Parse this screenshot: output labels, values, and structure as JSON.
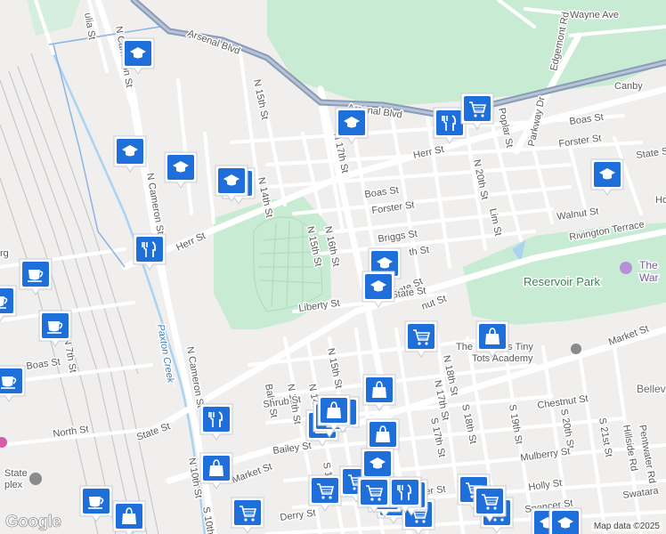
{
  "colors": {
    "accent": "#1a73e8",
    "marker_bg": "#1e6fd9",
    "park": "#c8ecd3",
    "road": "#ffffff",
    "highway": "#8a9bb5",
    "water": "#a9d3f0"
  },
  "attribution": "Map data ©2025",
  "logo": "Google",
  "streets": [
    {
      "label": "Arsenal Blvd",
      "rot": 20
    },
    {
      "label": "Arsenal Blvd",
      "rot": 8
    },
    {
      "label": "Wayne Ave",
      "rot": 0
    },
    {
      "label": "Edgemont Rd",
      "rot": -78
    },
    {
      "label": "Herr St",
      "rot": -12
    },
    {
      "label": "Canby",
      "rot": 0
    },
    {
      "label": "Boas St",
      "rot": -8
    },
    {
      "label": "Forster St",
      "rot": -8
    },
    {
      "label": "State St",
      "rot": -8
    },
    {
      "label": "Parkway Dr",
      "rot": -78
    },
    {
      "label": "Poplar St",
      "rot": 78
    },
    {
      "label": "N 20th St",
      "rot": 78
    },
    {
      "label": "N 17th St",
      "rot": 78
    },
    {
      "label": "N 15th St",
      "rot": 78
    },
    {
      "label": "N 14th St",
      "rot": 78
    },
    {
      "label": "N 16th St",
      "rot": 78
    },
    {
      "label": "N 15th St",
      "rot": 78
    },
    {
      "label": "Boas St",
      "rot": -8
    },
    {
      "label": "Forster St",
      "rot": -8
    },
    {
      "label": "Briggs St",
      "rot": -8
    },
    {
      "label": "Lim St",
      "rot": 78
    },
    {
      "label": "Walnut St",
      "rot": -8
    },
    {
      "label": "Rivington Terrace",
      "rot": -10
    },
    {
      "label": "Herr St",
      "rot": -25
    },
    {
      "label": "Liberty St",
      "rot": -8
    },
    {
      "label": "State St",
      "rot": -25
    },
    {
      "label": "nut St",
      "rot": -20
    },
    {
      "label": "th St",
      "rot": -8
    },
    {
      "label": "N Cameron St",
      "rot": 80
    },
    {
      "label": "N Cameron St",
      "rot": 80
    },
    {
      "label": "N Cameron St",
      "rot": 80
    },
    {
      "label": "ulia St",
      "rot": 80
    },
    {
      "label": "Boas St",
      "rot": -8
    },
    {
      "label": "N 7th St",
      "rot": 80
    },
    {
      "label": "North St",
      "rot": -8
    },
    {
      "label": "State St",
      "rot": -20
    },
    {
      "label": "N 10th St",
      "rot": 80
    },
    {
      "label": "Market St",
      "rot": -20
    },
    {
      "label": "Market St",
      "rot": -20
    },
    {
      "label": "Balm St",
      "rot": 80
    },
    {
      "label": "N 13th St",
      "rot": 80
    },
    {
      "label": "N 14th St",
      "rot": 80
    },
    {
      "label": "N 15th St",
      "rot": 78
    },
    {
      "label": "Shrub St",
      "rot": -8
    },
    {
      "label": "Bailey St",
      "rot": -8
    },
    {
      "label": "N 17th St",
      "rot": 78
    },
    {
      "label": "N 18th St",
      "rot": 78
    },
    {
      "label": "S 17th St",
      "rot": 78
    },
    {
      "label": "S 18th St",
      "rot": 78
    },
    {
      "label": "S 19th St",
      "rot": 80
    },
    {
      "label": "Chestnut St",
      "rot": -8
    },
    {
      "label": "S 20th St",
      "rot": 80
    },
    {
      "label": "S 21st St",
      "rot": 80
    },
    {
      "label": "Hillside Rd",
      "rot": 80
    },
    {
      "label": "Pentwater Rd",
      "rot": 80
    },
    {
      "label": "Mulberry St",
      "rot": -8
    },
    {
      "label": "Holly St",
      "rot": -8
    },
    {
      "label": "Spencer St",
      "rot": -8
    },
    {
      "label": "Swatara",
      "rot": -8
    },
    {
      "label": "Derry St",
      "rot": -8
    },
    {
      "label": "S 10th St",
      "rot": 80
    },
    {
      "label": "S 13",
      "rot": 80
    },
    {
      "label": "wer St",
      "rot": -8
    },
    {
      "label": "State St",
      "rot": -8
    },
    {
      "label": "Ho",
      "rot": 0
    },
    {
      "label": "rg",
      "rot": 0
    }
  ],
  "places": {
    "park": "Reservoir Park",
    "poi": "The War",
    "poi_line1": "The",
    "poi_line2": "War",
    "creek": "Paxton Creek",
    "academy_line1": "The Rangers Tiny",
    "academy_line2": "Tots Academy",
    "bellevue": "Bellev",
    "complex_line1": "State",
    "complex_line2": "plex"
  },
  "markers": [
    {
      "icon": "school-icon",
      "type": "school"
    },
    {
      "icon": "school-icon",
      "type": "school"
    },
    {
      "icon": "school-icon",
      "type": "school"
    },
    {
      "icon": "school-icon",
      "type": "school"
    },
    {
      "icon": "school-icon",
      "type": "school"
    },
    {
      "icon": "school-icon",
      "type": "school"
    },
    {
      "icon": "school-icon",
      "type": "school"
    },
    {
      "icon": "school-icon",
      "type": "school"
    },
    {
      "icon": "restaurant-icon",
      "type": "restaurant"
    },
    {
      "icon": "restaurant-icon",
      "type": "restaurant"
    },
    {
      "icon": "restaurant-icon",
      "type": "restaurant"
    },
    {
      "icon": "shopping-cart-icon",
      "type": "grocery"
    },
    {
      "icon": "shopping-cart-icon",
      "type": "grocery"
    },
    {
      "icon": "shopping-bag-icon",
      "type": "shopping"
    },
    {
      "icon": "shopping-bag-icon",
      "type": "shopping"
    },
    {
      "icon": "shopping-bag-icon",
      "type": "shopping"
    },
    {
      "icon": "shopping-bag-icon",
      "type": "shopping"
    },
    {
      "icon": "shopping-bag-icon",
      "type": "shopping"
    },
    {
      "icon": "coffee-icon",
      "type": "cafe"
    },
    {
      "icon": "coffee-icon",
      "type": "cafe"
    },
    {
      "icon": "coffee-icon",
      "type": "cafe"
    },
    {
      "icon": "coffee-icon",
      "type": "cafe"
    },
    {
      "icon": "shopping-cart-icon",
      "type": "grocery"
    },
    {
      "icon": "shopping-cart-icon",
      "type": "grocery"
    },
    {
      "icon": "shopping-cart-icon",
      "type": "grocery"
    },
    {
      "icon": "shopping-cart-icon",
      "type": "grocery"
    },
    {
      "icon": "shopping-cart-icon",
      "type": "grocery"
    },
    {
      "icon": "shopping-cart-icon",
      "type": "grocery"
    },
    {
      "icon": "shopping-cart-icon",
      "type": "grocery"
    },
    {
      "icon": "shopping-bag-icon",
      "type": "shopping"
    },
    {
      "icon": "shopping-bag-icon",
      "type": "shopping"
    },
    {
      "icon": "shopping-bag-icon",
      "type": "shopping"
    },
    {
      "icon": "coffee-icon",
      "type": "cafe"
    },
    {
      "icon": "school-icon",
      "type": "school"
    },
    {
      "icon": "restaurant-icon",
      "type": "restaurant"
    },
    {
      "icon": "shopping-cart-icon",
      "type": "grocery"
    },
    {
      "icon": "school-icon",
      "type": "school"
    },
    {
      "icon": "school-icon",
      "type": "school"
    },
    {
      "icon": "shopping-bag-icon",
      "type": "shopping"
    },
    {
      "icon": "restaurant-icon",
      "type": "restaurant"
    },
    {
      "icon": "shopping-cart-icon",
      "type": "grocery"
    },
    {
      "icon": "shopping-cart-icon",
      "type": "grocery"
    },
    {
      "icon": "school-icon",
      "type": "school"
    }
  ]
}
